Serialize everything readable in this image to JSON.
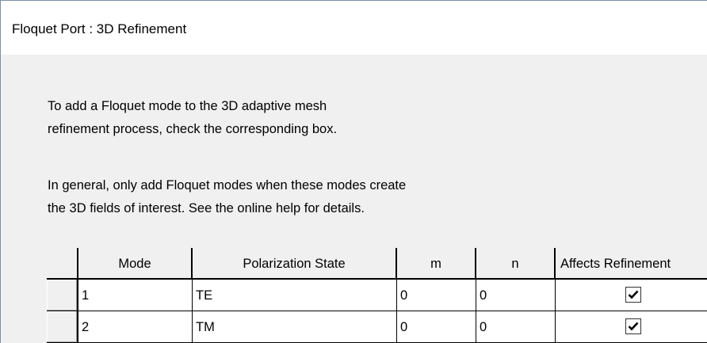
{
  "window": {
    "title": "Floquet Port : 3D Refinement"
  },
  "instructions": {
    "line1": "To add a Floquet mode to the 3D adaptive mesh",
    "line2": "refinement process, check the corresponding box.",
    "line3": "In general, only add Floquet modes when these modes create",
    "line4": "the 3D fields of interest.  See the online help for details."
  },
  "table": {
    "headers": {
      "mode": "Mode",
      "polarization": "Polarization State",
      "m": "m",
      "n": "n",
      "affects": "Affects Refinement"
    },
    "rows": [
      {
        "mode": "1",
        "polarization": "TE",
        "m": "0",
        "n": "0",
        "affects_refinement": true
      },
      {
        "mode": "2",
        "polarization": "TM",
        "m": "0",
        "n": "0",
        "affects_refinement": true
      }
    ]
  },
  "icons": {
    "checkmark": "checkmark-icon"
  }
}
